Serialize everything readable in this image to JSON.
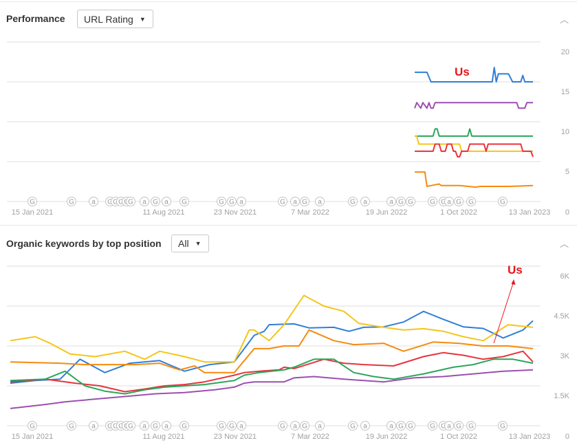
{
  "performance": {
    "title": "Performance",
    "metric_dropdown": "URL Rating",
    "collapse_icon": "chevron-up-icon"
  },
  "organic": {
    "title": "Organic keywords by top position",
    "filter_dropdown": "All",
    "collapse_icon": "chevron-up-icon"
  },
  "annotation_label": "Us",
  "x_tick_labels": [
    "15 Jan 2021",
    "11 Aug 2021",
    "23 Nov 2021",
    "7 Mar 2022",
    "19 Jun 2022",
    "1 Oct 2022",
    "13 Jan 2023"
  ],
  "timeline_markers": [
    "G",
    "G",
    "a",
    "G",
    "G",
    "G",
    "G",
    "G",
    "a",
    "G",
    "a",
    "G",
    "G",
    "G",
    "a",
    "G",
    "a",
    "G",
    "a",
    "G",
    "a",
    "a",
    "G",
    "G",
    "G",
    "G",
    "a",
    "G",
    "G",
    "G"
  ],
  "colors": {
    "blue": "#2f7ed8",
    "purple": "#9b4fb0",
    "green": "#2aa55a",
    "yellow": "#f5c518",
    "red": "#e8333a",
    "orange": "#f68a0e",
    "annotation": "#e8141a",
    "grid": "#efefef",
    "tick": "#a0a0a0"
  },
  "chart_data": [
    {
      "type": "line",
      "title": "Performance — URL Rating",
      "xlabel": "",
      "ylabel": "",
      "x_range": [
        "15 Jan 2021",
        "13 Jan 2023"
      ],
      "x_ticks": [
        "15 Jan 2021",
        "11 Aug 2021",
        "23 Nov 2021",
        "7 Mar 2022",
        "19 Jun 2022",
        "1 Oct 2022",
        "13 Jan 2023"
      ],
      "y_ticks": [
        "20",
        "15",
        "10",
        "5",
        "0"
      ],
      "ylim": [
        0,
        20
      ],
      "grid": true,
      "annotations": [
        {
          "text": "Us",
          "series": "Us (blue)"
        }
      ],
      "x_note": "series start ~Aug 2022; x given as fraction of timeline 0=15 Jan 2021, 1=13 Jan 2023",
      "series": [
        {
          "name": "Us (blue)",
          "color": "blue",
          "x": [
            0.77,
            0.8,
            0.81,
            0.96,
            0.965,
            0.97,
            0.975,
            1.0,
            1.01,
            1.03,
            1.035,
            1.04,
            1.045,
            1.06
          ],
          "y": [
            16.2,
            16.2,
            15.0,
            15.0,
            16.8,
            15.0,
            16.0,
            16.0,
            15.0,
            15.0,
            15.8,
            15.0,
            15.0,
            15.0
          ]
        },
        {
          "name": "Purple",
          "color": "purple",
          "x": [
            0.77,
            0.775,
            0.785,
            0.79,
            0.8,
            0.805,
            0.81,
            0.815,
            0.82,
            1.02,
            1.025,
            1.04,
            1.045,
            1.06
          ],
          "y": [
            11.7,
            12.4,
            11.7,
            12.4,
            11.7,
            12.4,
            11.7,
            11.7,
            12.4,
            12.4,
            11.7,
            11.7,
            12.4,
            12.4
          ]
        },
        {
          "name": "Green",
          "color": "green",
          "x": [
            0.77,
            0.815,
            0.82,
            0.825,
            0.83,
            0.9,
            0.905,
            0.91,
            1.06
          ],
          "y": [
            8.2,
            8.2,
            9.1,
            9.1,
            8.2,
            8.2,
            9.1,
            8.2,
            8.2
          ]
        },
        {
          "name": "Yellow",
          "color": "yellow",
          "x": [
            0.77,
            0.775,
            0.78,
            0.88,
            0.885,
            1.06
          ],
          "y": [
            8.2,
            8.2,
            7.2,
            7.2,
            6.3,
            6.3
          ]
        },
        {
          "name": "Red",
          "color": "red",
          "x": [
            0.77,
            0.815,
            0.82,
            0.83,
            0.835,
            0.845,
            0.85,
            0.86,
            0.865,
            0.87,
            0.875,
            0.88,
            0.885,
            0.89,
            0.9,
            0.905,
            0.94,
            0.945,
            0.95,
            1.03,
            1.035,
            1.055,
            1.06
          ],
          "y": [
            6.3,
            6.3,
            7.2,
            7.2,
            6.3,
            6.3,
            7.2,
            7.2,
            6.3,
            6.3,
            5.6,
            5.6,
            6.3,
            6.3,
            6.3,
            7.2,
            7.2,
            6.3,
            7.2,
            7.2,
            6.3,
            6.3,
            5.6
          ]
        },
        {
          "name": "Orange",
          "color": "orange",
          "x": [
            0.77,
            0.795,
            0.8,
            0.81,
            0.83,
            0.835,
            0.88,
            0.92,
            0.93,
            0.95,
            1.0,
            1.06
          ],
          "y": [
            3.7,
            3.7,
            1.9,
            2.0,
            2.2,
            2.0,
            2.0,
            1.8,
            1.9,
            1.9,
            1.9,
            2.0
          ]
        }
      ]
    },
    {
      "type": "line",
      "title": "Organic keywords by top position",
      "xlabel": "",
      "ylabel": "",
      "x_range": [
        "15 Jan 2021",
        "13 Jan 2023"
      ],
      "x_ticks": [
        "15 Jan 2021",
        "11 Aug 2021",
        "23 Nov 2021",
        "7 Mar 2022",
        "19 Jun 2022",
        "1 Oct 2022",
        "13 Jan 2023"
      ],
      "y_ticks": [
        "6K",
        "4.5K",
        "3K",
        "1.5K",
        "0"
      ],
      "ylim": [
        0,
        6000
      ],
      "grid": true,
      "annotations": [
        {
          "text": "Us",
          "series": "Us (blue)",
          "arrow": true
        }
      ],
      "x_note": "x as fraction of timeline 0=15 Jan 2021, 1=13 Jan 2023",
      "series": [
        {
          "name": "Us (blue)",
          "color": "blue",
          "x": [
            -0.05,
            0.0,
            0.05,
            0.09,
            0.14,
            0.19,
            0.25,
            0.3,
            0.35,
            0.4,
            0.44,
            0.46,
            0.47,
            0.52,
            0.55,
            0.6,
            0.63,
            0.66,
            0.7,
            0.74,
            0.78,
            0.82,
            0.86,
            0.9,
            0.94,
            0.98,
            1.0
          ],
          "y": [
            1600,
            1700,
            1750,
            2500,
            2000,
            2350,
            2450,
            2050,
            2300,
            2400,
            3400,
            3550,
            3800,
            3830,
            3680,
            3700,
            3550,
            3700,
            3720,
            3900,
            4300,
            4000,
            3720,
            3660,
            3300,
            3600,
            3950
          ]
        },
        {
          "name": "Yellow",
          "color": "yellow",
          "x": [
            -0.05,
            0.0,
            0.03,
            0.07,
            0.12,
            0.18,
            0.22,
            0.25,
            0.3,
            0.34,
            0.4,
            0.43,
            0.44,
            0.47,
            0.5,
            0.54,
            0.58,
            0.62,
            0.65,
            0.7,
            0.74,
            0.78,
            0.82,
            0.86,
            0.9,
            0.95,
            1.0
          ],
          "y": [
            3200,
            3350,
            3100,
            2700,
            2600,
            2800,
            2500,
            2800,
            2600,
            2400,
            2400,
            3600,
            3600,
            3200,
            3800,
            4900,
            4500,
            4300,
            3850,
            3700,
            3600,
            3650,
            3550,
            3350,
            3200,
            3800,
            3700
          ]
        },
        {
          "name": "Orange",
          "color": "orange",
          "x": [
            -0.05,
            0.05,
            0.1,
            0.15,
            0.2,
            0.25,
            0.29,
            0.32,
            0.34,
            0.38,
            0.4,
            0.44,
            0.47,
            0.5,
            0.53,
            0.55,
            0.6,
            0.64,
            0.7,
            0.74,
            0.8,
            0.85,
            0.9,
            0.95,
            1.0
          ],
          "y": [
            2400,
            2350,
            2300,
            2300,
            2300,
            2350,
            2100,
            2250,
            2000,
            2000,
            2000,
            2900,
            2900,
            3000,
            3000,
            3600,
            3200,
            3050,
            3100,
            2800,
            3150,
            3100,
            3000,
            3000,
            2900
          ]
        },
        {
          "name": "Red",
          "color": "red",
          "x": [
            -0.05,
            0.02,
            0.08,
            0.13,
            0.18,
            0.22,
            0.26,
            0.3,
            0.34,
            0.4,
            0.42,
            0.45,
            0.49,
            0.5,
            0.52,
            0.58,
            0.62,
            0.66,
            0.72,
            0.78,
            0.82,
            0.86,
            0.9,
            0.94,
            0.98,
            1.0
          ],
          "y": [
            1650,
            1750,
            1600,
            1500,
            1280,
            1380,
            1500,
            1550,
            1650,
            1900,
            2000,
            2050,
            2100,
            2200,
            2150,
            2500,
            2350,
            2300,
            2250,
            2600,
            2750,
            2650,
            2500,
            2600,
            2800,
            2400
          ]
        },
        {
          "name": "Green",
          "color": "green",
          "x": [
            -0.05,
            0.02,
            0.06,
            0.1,
            0.14,
            0.18,
            0.22,
            0.26,
            0.3,
            0.34,
            0.4,
            0.42,
            0.45,
            0.5,
            0.52,
            0.56,
            0.6,
            0.64,
            0.68,
            0.72,
            0.78,
            0.84,
            0.88,
            0.92,
            0.96,
            1.0
          ],
          "y": [
            1700,
            1750,
            2050,
            1500,
            1300,
            1200,
            1350,
            1450,
            1500,
            1550,
            1700,
            1900,
            2000,
            2100,
            2200,
            2500,
            2500,
            2000,
            1850,
            1750,
            1950,
            2200,
            2300,
            2500,
            2500,
            2350
          ]
        },
        {
          "name": "Purple",
          "color": "purple",
          "x": [
            -0.05,
            0.02,
            0.06,
            0.12,
            0.18,
            0.24,
            0.3,
            0.36,
            0.4,
            0.42,
            0.44,
            0.5,
            0.52,
            0.56,
            0.62,
            0.66,
            0.7,
            0.76,
            0.82,
            0.88,
            0.94,
            1.0
          ],
          "y": [
            650,
            800,
            900,
            1000,
            1100,
            1200,
            1250,
            1350,
            1450,
            1600,
            1650,
            1650,
            1800,
            1850,
            1750,
            1700,
            1650,
            1800,
            1850,
            1950,
            2050,
            2100
          ]
        }
      ]
    }
  ]
}
